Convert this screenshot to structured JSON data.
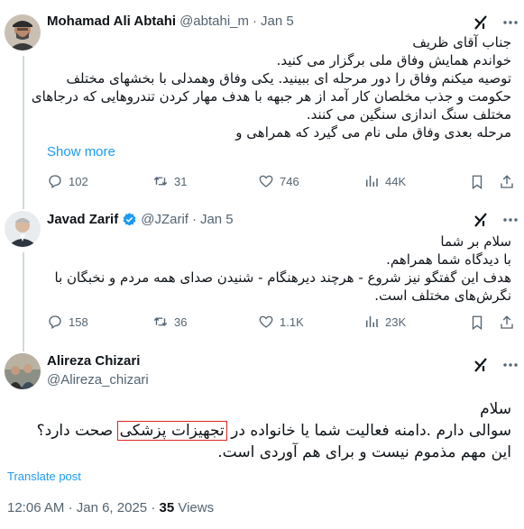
{
  "tweets": [
    {
      "name": "Mohamad Ali Abtahi",
      "handle": "@abtahi_m",
      "date": "Jan 5",
      "lines": [
        "جناب آقای ظریف",
        "خواندم همایش وفاق ملی برگزار می کنید.",
        "توصیه میکنم وفاق را دور مرحله ای ببینید. یکی وفاق وهمدلی با بخشهای مختلف",
        "حکومت و جذب مخلصان کار آمد از هر جبهه با هدف مهار کردن تندروهایی که درجاهای",
        "مختلف سنگ اندازی سنگین می کنند.",
        "مرحله بعدی وفاق ملی نام می گیرد که همراهی و"
      ],
      "show_more": "Show more",
      "stats": {
        "replies": "102",
        "retweets": "31",
        "likes": "746",
        "views": "44K"
      }
    },
    {
      "name": "Javad Zarif",
      "handle": "@JZarif",
      "date": "Jan 5",
      "lines": [
        "سلام بر شما",
        "با دیدگاه شما همراهم.",
        "هدف این گفتگو نیز شروع - هرچند دیرهنگام - شنیدن صدای همه مردم و نخبگان با",
        "نگرش‌های مختلف است."
      ],
      "stats": {
        "replies": "158",
        "retweets": "36",
        "likes": "1.1K",
        "views": "23K"
      }
    }
  ],
  "main_tweet": {
    "name": "Alireza Chizari",
    "handle": "@Alireza_chizari",
    "line1": "سلام",
    "line2_before": "سوالی دارم .دامنه فعالیت شما یا خانواده در",
    "line2_highlight": "تجهیزات پزشکی",
    "line2_after": "صحت دارد؟",
    "line3": "این مهم مذموم نیست و برای هم آوردی است.",
    "translate": "Translate post",
    "time": "12:06 AM",
    "date": "Jan 6, 2025",
    "views_count": "35",
    "views_label": "Views"
  },
  "colors": {
    "accent": "#1d9bf0",
    "muted": "#536471",
    "text": "#0f1419",
    "highlight_box": "#e02424",
    "verified": "#1d9bf0"
  }
}
